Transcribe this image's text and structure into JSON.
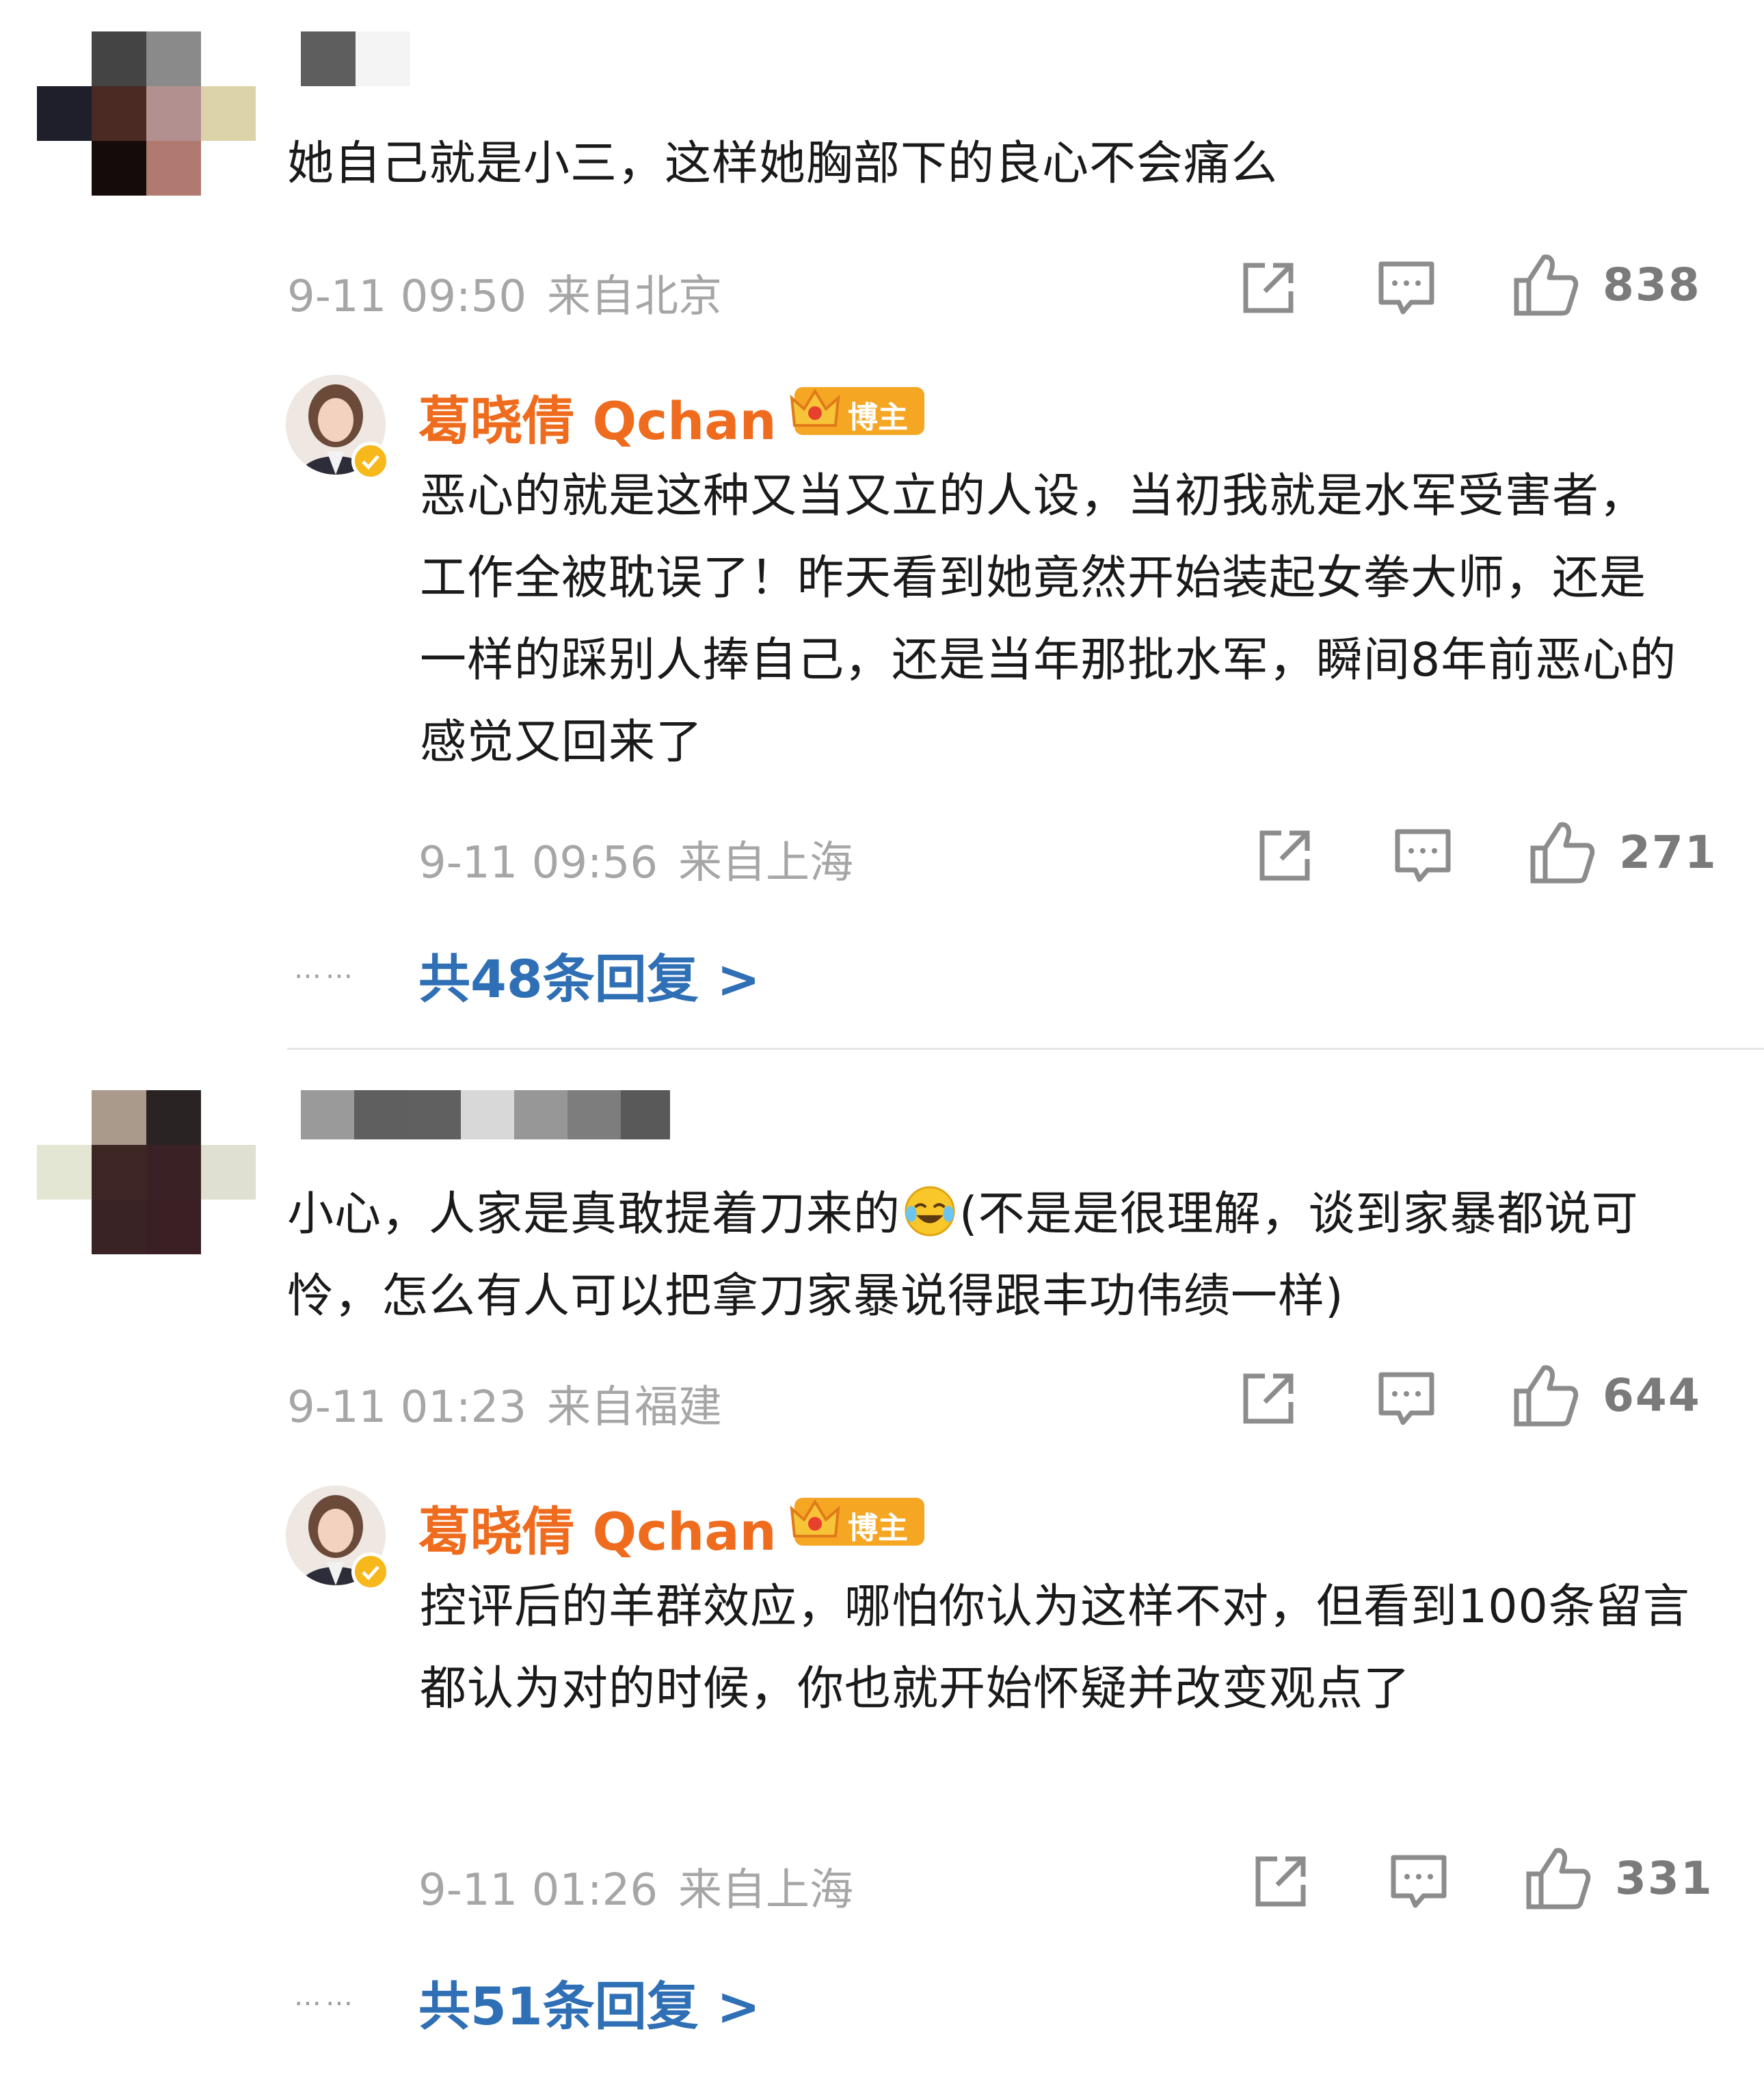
{
  "comments": [
    {
      "text": "她自己就是小三，这样她胸部下的良心不会痛么",
      "date": "9-11 09:50",
      "location": "来自北京",
      "likes": "838",
      "reply": {
        "name": "葛晓倩 Qchan",
        "badge": "博主",
        "text": "恶心的就是这种又当又立的人设，当初我就是水军受害者，工作全被耽误了！昨天看到她竟然开始装起女拳大师，还是一样的踩别人捧自己，还是当年那批水军，瞬间8年前恶心的感觉又回来了",
        "date": "9-11 09:56",
        "location": "来自上海",
        "likes": "271"
      },
      "more_replies": "共48条回复 >"
    },
    {
      "text_before_emoji": "小心，人家是真敢提着刀来的",
      "text_after_emoji": "(不是是很理解，谈到家暴都说可怜，怎么有人可以把拿刀家暴说得跟丰功伟绩一样)",
      "date": "9-11 01:23",
      "location": "来自福建",
      "likes": "644",
      "reply": {
        "name": "葛晓倩 Qchan",
        "badge": "博主",
        "text": "控评后的羊群效应，哪怕你认为这样不对，但看到100条留言都认为对的时候，你也就开始怀疑并改变观点了",
        "date": "9-11 01:26",
        "location": "来自上海",
        "likes": "331"
      },
      "more_replies": "共51条回复 >"
    }
  ],
  "more_dots": "……",
  "icons": {
    "share": "share-icon",
    "comment": "comment-icon",
    "like": "thumbs-up-icon",
    "crown": "crown-icon",
    "verify": "verified-icon",
    "emoji": "laugh-cry-emoji-icon"
  },
  "colors": {
    "reply_name": "#ef6b1d",
    "link": "#2f6fb5",
    "meta": "#a6a6a6",
    "badge": "#f5a623"
  }
}
